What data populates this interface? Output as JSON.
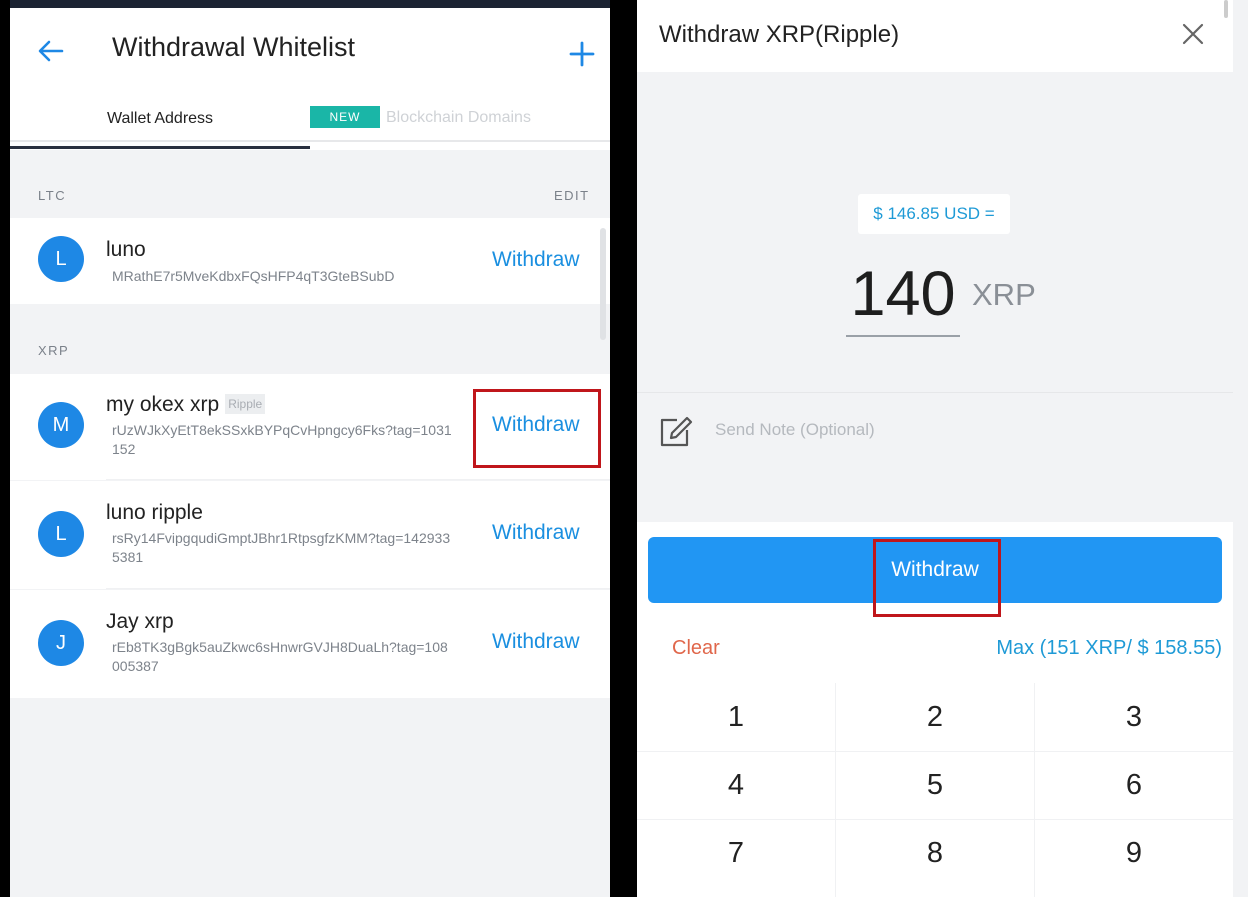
{
  "whitelist": {
    "title": "Withdrawal Whitelist",
    "tabs": {
      "wallet_address": "Wallet Address",
      "new_badge": "NEW",
      "blockchain_domains": "Blockchain Domains"
    },
    "edit_label": "EDIT",
    "sections": [
      {
        "label": "LTC",
        "entries": [
          {
            "initial": "L",
            "name": "luno",
            "tag": "",
            "address": "MRathE7r5MveKdbxFQsHFP4qT3GteBSubD",
            "action": "Withdraw"
          }
        ]
      },
      {
        "label": "XRP",
        "entries": [
          {
            "initial": "M",
            "name": "my okex xrp",
            "tag": "Ripple",
            "address": "rUzWJkXyEtT8ekSSxkBYPqCvHpngcy6Fks?tag=1031152",
            "action": "Withdraw"
          },
          {
            "initial": "L",
            "name": "luno ripple",
            "tag": "",
            "address": "rsRy14FvipgqudiGmptJBhr1RtpsgfzKMM?tag=1429335381",
            "action": "Withdraw"
          },
          {
            "initial": "J",
            "name": "Jay xrp",
            "tag": "",
            "address": "rEb8TK3gBgk5auZkwc6sHnwrGVJH8DuaLh?tag=108005387",
            "action": "Withdraw"
          }
        ]
      }
    ]
  },
  "withdraw_sheet": {
    "title": "Withdraw XRP(Ripple)",
    "usd_equivalent": "$ 146.85 USD =",
    "amount": "140",
    "unit": "XRP",
    "note_placeholder": "Send Note (Optional)",
    "withdraw_button": "Withdraw",
    "clear_label": "Clear",
    "max_label": "Max (151 XRP/ $ 158.55)",
    "keypad": [
      "1",
      "2",
      "3",
      "4",
      "5",
      "6",
      "7",
      "8",
      "9"
    ]
  },
  "colors": {
    "accent_blue": "#2196f3",
    "link_blue": "#1a8fe0",
    "new_badge": "#1ab6a7",
    "clear_red": "#e0674b",
    "highlight_red": "#c0161b"
  },
  "icons": [
    "back-arrow-icon",
    "plus-icon",
    "close-icon",
    "edit-note-icon"
  ]
}
